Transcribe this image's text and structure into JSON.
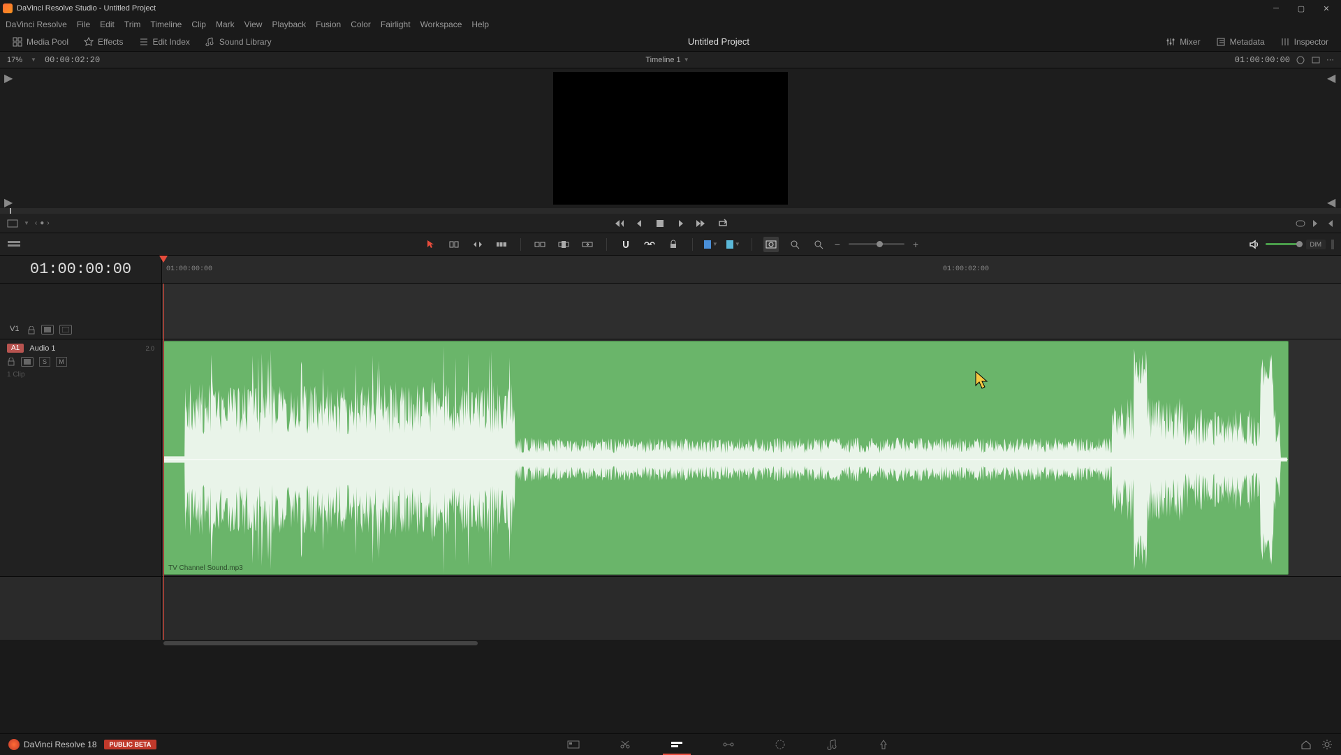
{
  "titlebar": {
    "text": "DaVinci Resolve Studio - Untitled Project"
  },
  "menu": {
    "items": [
      "DaVinci Resolve",
      "File",
      "Edit",
      "Trim",
      "Timeline",
      "Clip",
      "Mark",
      "View",
      "Playback",
      "Fusion",
      "Color",
      "Fairlight",
      "Workspace",
      "Help"
    ]
  },
  "panels": {
    "media_pool": "Media Pool",
    "effects": "Effects",
    "edit_index": "Edit Index",
    "sound_library": "Sound Library",
    "mixer": "Mixer",
    "metadata": "Metadata",
    "inspector": "Inspector",
    "project_title": "Untitled Project"
  },
  "viewer": {
    "zoom": "17%",
    "duration_tc": "00:00:02:20",
    "timeline_name": "Timeline 1",
    "current_tc": "01:00:00:00"
  },
  "timeline": {
    "playhead_tc": "01:00:00:00",
    "ruler_labels": [
      "01:00:00:00",
      "01:00:02:00"
    ],
    "video_track": {
      "label": "V1"
    },
    "audio_track": {
      "badge": "A1",
      "name": "Audio 1",
      "channels": "2.0",
      "solo": "S",
      "mute": "M",
      "clip_count": "1 Clip"
    },
    "clip": {
      "name": "TV Channel Sound.mp3"
    }
  },
  "toolbar": {
    "dim": "DIM"
  },
  "bottom": {
    "app_name": "DaVinci Resolve 18",
    "beta": "PUBLIC BETA"
  }
}
